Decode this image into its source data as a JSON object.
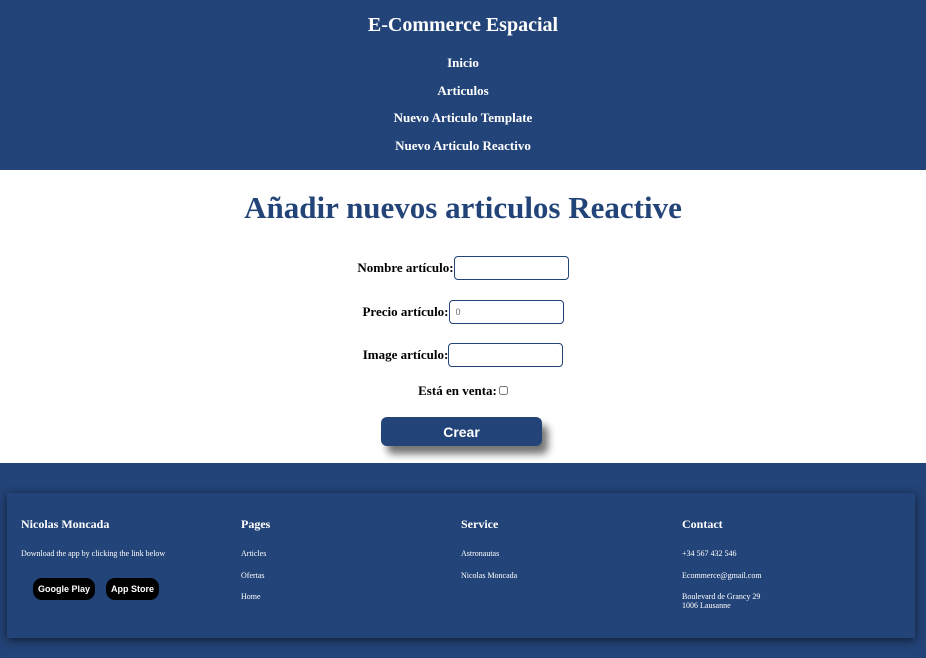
{
  "header": {
    "title": "E-Commerce Espacial",
    "nav": [
      "Inicio",
      "Articulos",
      "Nuevo Articulo Template",
      "Nuevo Articulo Reactivo"
    ]
  },
  "main": {
    "heading": "Añadir nuevos articulos Reactive",
    "form": {
      "name_label": "Nombre artículo:",
      "name_value": "",
      "price_label": "Precio artículo:",
      "price_value": "0",
      "image_label": "Image artículo:",
      "image_value": "",
      "sale_label": "Está en venta:",
      "sale_checked": false,
      "submit_label": "Crear"
    }
  },
  "footer": {
    "brand": {
      "title": "Nicolas Moncada",
      "text": "Download the app by clicking the link below",
      "google_play": "Google Play",
      "app_store": "App Store"
    },
    "pages": {
      "title": "Pages",
      "items": [
        "Articles",
        "Ofertas",
        "Home"
      ]
    },
    "service": {
      "title": "Service",
      "items": [
        "Astronautas",
        "Nicolas Moncada"
      ]
    },
    "contact": {
      "title": "Contact",
      "phone": "+34 567 432 546",
      "email": "Ecommerce@gmail.com",
      "address_line1": "Boulevard de Grancy 29",
      "address_line2": "1006 Lausanne"
    }
  },
  "colors": {
    "brand_blue": "#234478",
    "white": "#ffffff",
    "black": "#000000"
  }
}
